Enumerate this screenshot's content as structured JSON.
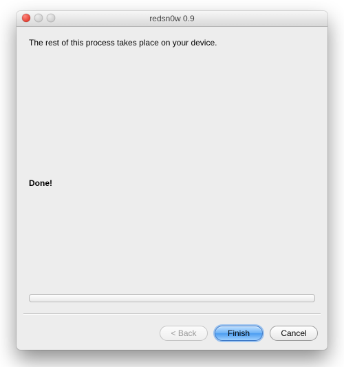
{
  "window": {
    "title": "redsn0w 0.9"
  },
  "content": {
    "instruction": "The rest of this process takes place on your device.",
    "status": "Done!"
  },
  "footer": {
    "back_label": "< Back",
    "finish_label": "Finish",
    "cancel_label": "Cancel"
  }
}
